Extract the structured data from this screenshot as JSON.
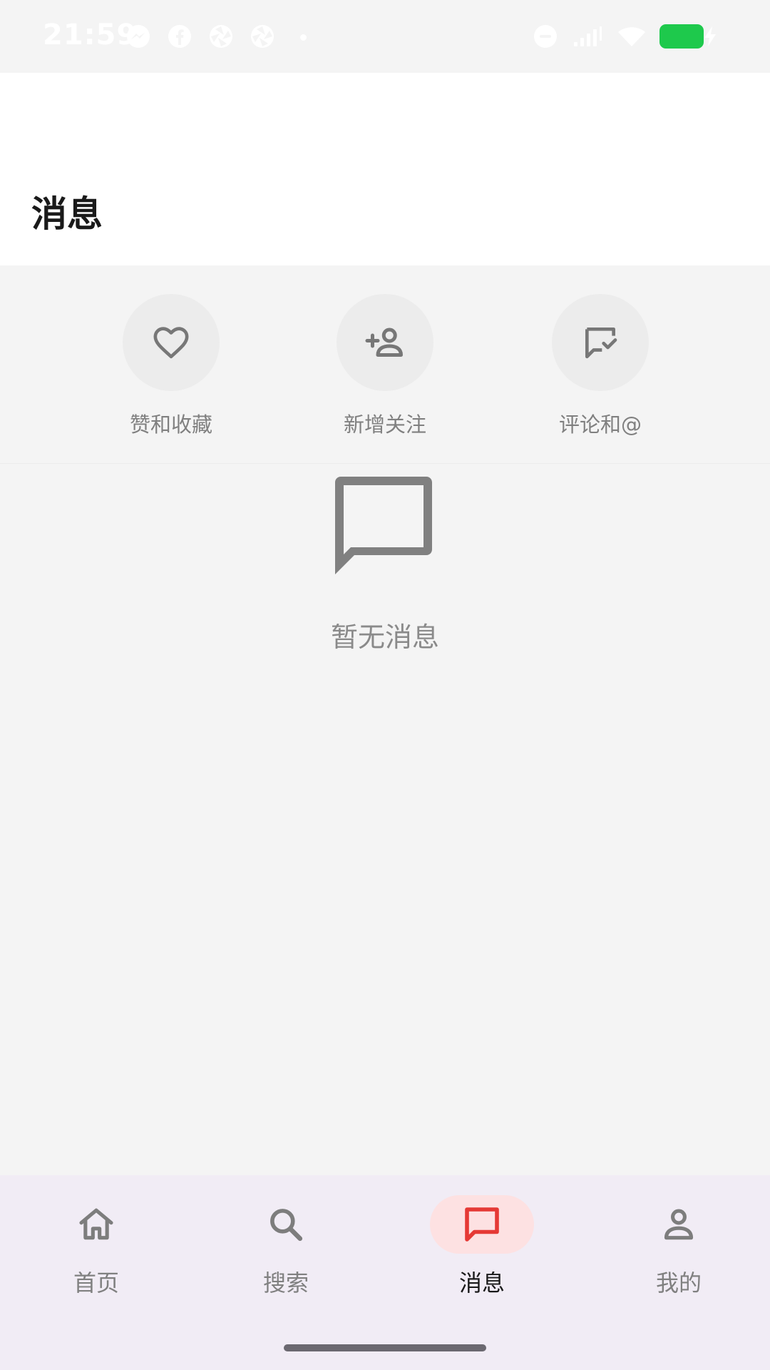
{
  "status_bar": {
    "time": "21:59",
    "left_icons": [
      "messenger-icon",
      "facebook-icon",
      "aperture-icon",
      "aperture-icon"
    ],
    "right_icons": [
      "do-not-disturb-icon",
      "signal-icon",
      "wifi-icon",
      "battery-charging-icon"
    ],
    "battery_color": "#1ec94c"
  },
  "header": {
    "title": "消息"
  },
  "shortcuts": [
    {
      "label": "赞和收藏",
      "icon": "heart-icon"
    },
    {
      "label": "新增关注",
      "icon": "person-add-icon"
    },
    {
      "label": "评论和@",
      "icon": "comment-check-icon"
    }
  ],
  "empty_state": {
    "icon": "chat-bubble-icon",
    "text": "暂无消息"
  },
  "bottom_nav": {
    "items": [
      {
        "label": "首页",
        "icon": "home-icon",
        "active": false
      },
      {
        "label": "搜索",
        "icon": "search-icon",
        "active": false
      },
      {
        "label": "消息",
        "icon": "message-icon",
        "active": true
      },
      {
        "label": "我的",
        "icon": "person-icon",
        "active": false
      }
    ],
    "active_color": "#e53935",
    "active_pill_color": "#fde1e2"
  }
}
